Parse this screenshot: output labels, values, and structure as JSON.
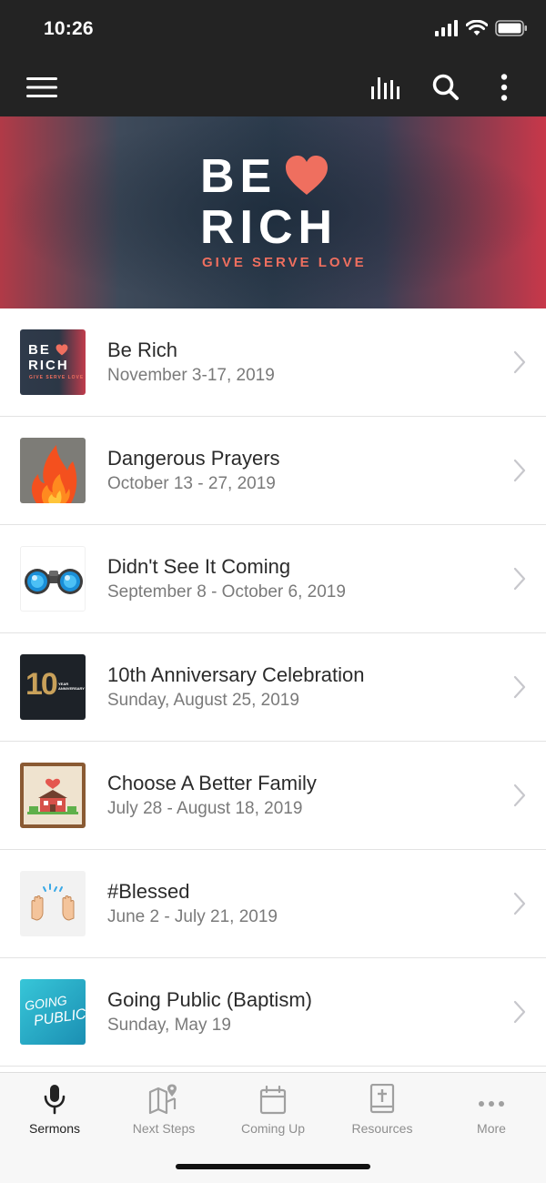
{
  "status_bar": {
    "time": "10:26"
  },
  "banner": {
    "line1": "BE",
    "line2": "RICH",
    "tagline": "GIVE SERVE LOVE",
    "accent_color": "#ef6f5f"
  },
  "series": [
    {
      "title": "Be Rich",
      "date": "November 3-17, 2019",
      "thumb_icon": "be-rich-thumbnail",
      "thumb_text1": "BE",
      "thumb_text2": "RICH",
      "thumb_text3": "GIVE SERVE LOVE"
    },
    {
      "title": "Dangerous Prayers",
      "date": "October 13 - 27, 2019",
      "thumb_icon": "fire-thumbnail"
    },
    {
      "title": "Didn't See It Coming",
      "date": "September 8 - October 6, 2019",
      "thumb_icon": "binoculars-thumbnail"
    },
    {
      "title": "10th Anniversary Celebration",
      "date": "Sunday, August 25, 2019",
      "thumb_icon": "anniversary-thumbnail",
      "thumb_text1": "10",
      "thumb_text2": "YEAR ANNIVERSARY"
    },
    {
      "title": "Choose A Better Family",
      "date": "July 28 - August 18, 2019",
      "thumb_icon": "cross-stitch-house-thumbnail"
    },
    {
      "title": "#Blessed",
      "date": "June 2 - July 21, 2019",
      "thumb_icon": "raised-hands-thumbnail"
    },
    {
      "title": "Going Public (Baptism)",
      "date": "Sunday, May 19",
      "thumb_icon": "going-public-thumbnail",
      "thumb_text1": "GOING",
      "thumb_text2": "PUBLIC"
    }
  ],
  "tabs": [
    {
      "label": "Sermons",
      "icon": "microphone-icon",
      "active": true
    },
    {
      "label": "Next Steps",
      "icon": "map-pin-icon",
      "active": false
    },
    {
      "label": "Coming Up",
      "icon": "calendar-icon",
      "active": false
    },
    {
      "label": "Resources",
      "icon": "bible-icon",
      "active": false
    },
    {
      "label": "More",
      "icon": "more-dots-icon",
      "active": false
    }
  ]
}
